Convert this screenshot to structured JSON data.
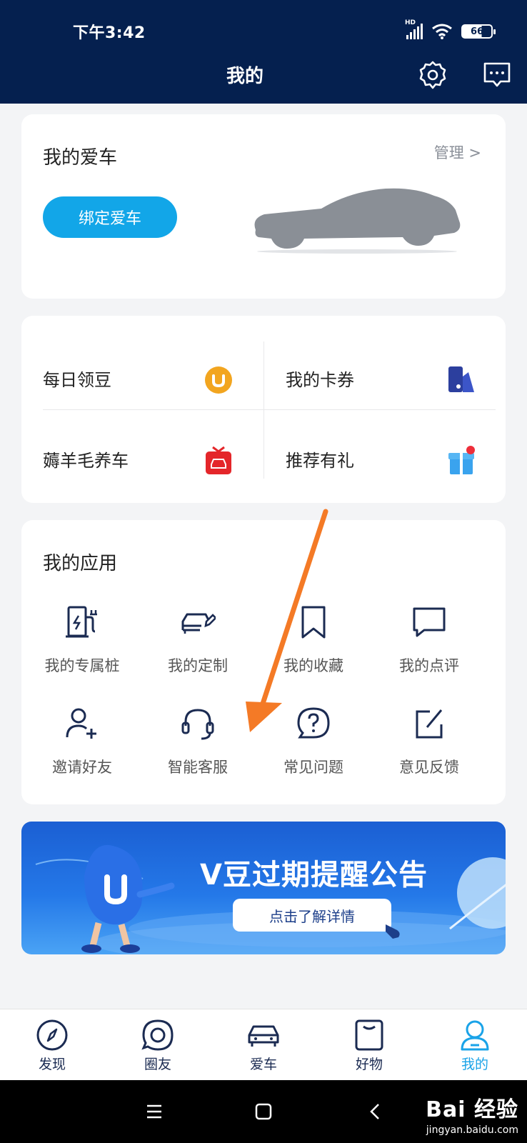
{
  "status_bar": {
    "time": "下午3:42",
    "signal_label": "HD",
    "battery": "66"
  },
  "header": {
    "title": "我的"
  },
  "car_card": {
    "title": "我的爱车",
    "manage_label": "管理 >",
    "bind_button": "绑定爱车"
  },
  "quick_grid": {
    "items": [
      {
        "label": "每日领豆",
        "icon": "v-coin-icon"
      },
      {
        "label": "我的卡券",
        "icon": "coupon-icon"
      },
      {
        "label": "薅羊毛养车",
        "icon": "red-gift-car-icon"
      },
      {
        "label": "推荐有礼",
        "icon": "gift-box-icon"
      }
    ]
  },
  "apps": {
    "title": "我的应用",
    "items": [
      {
        "label": "我的专属桩",
        "icon": "charging-pile-icon"
      },
      {
        "label": "我的定制",
        "icon": "car-edit-icon"
      },
      {
        "label": "我的收藏",
        "icon": "bookmark-icon"
      },
      {
        "label": "我的点评",
        "icon": "comment-icon"
      },
      {
        "label": "邀请好友",
        "icon": "user-plus-icon"
      },
      {
        "label": "智能客服",
        "icon": "headset-icon"
      },
      {
        "label": "常见问题",
        "icon": "question-icon"
      },
      {
        "label": "意见反馈",
        "icon": "feedback-edit-icon"
      }
    ]
  },
  "banner": {
    "title": "V豆过期提醒公告",
    "button": "点击了解详情"
  },
  "tabbar": {
    "items": [
      {
        "label": "发现",
        "icon": "compass-icon"
      },
      {
        "label": "圈友",
        "icon": "chat-circle-icon"
      },
      {
        "label": "爱车",
        "icon": "car-icon"
      },
      {
        "label": "好物",
        "icon": "bag-icon"
      },
      {
        "label": "我的",
        "icon": "person-icon"
      }
    ],
    "active_index": 4
  },
  "watermark": {
    "line1": "Bai 经验",
    "line2": "jingyan.baidu.com"
  },
  "colors": {
    "header_bg": "#05204f",
    "accent": "#12a6e8",
    "arrow": "#f47a26",
    "page_bg": "#f3f4f6"
  }
}
